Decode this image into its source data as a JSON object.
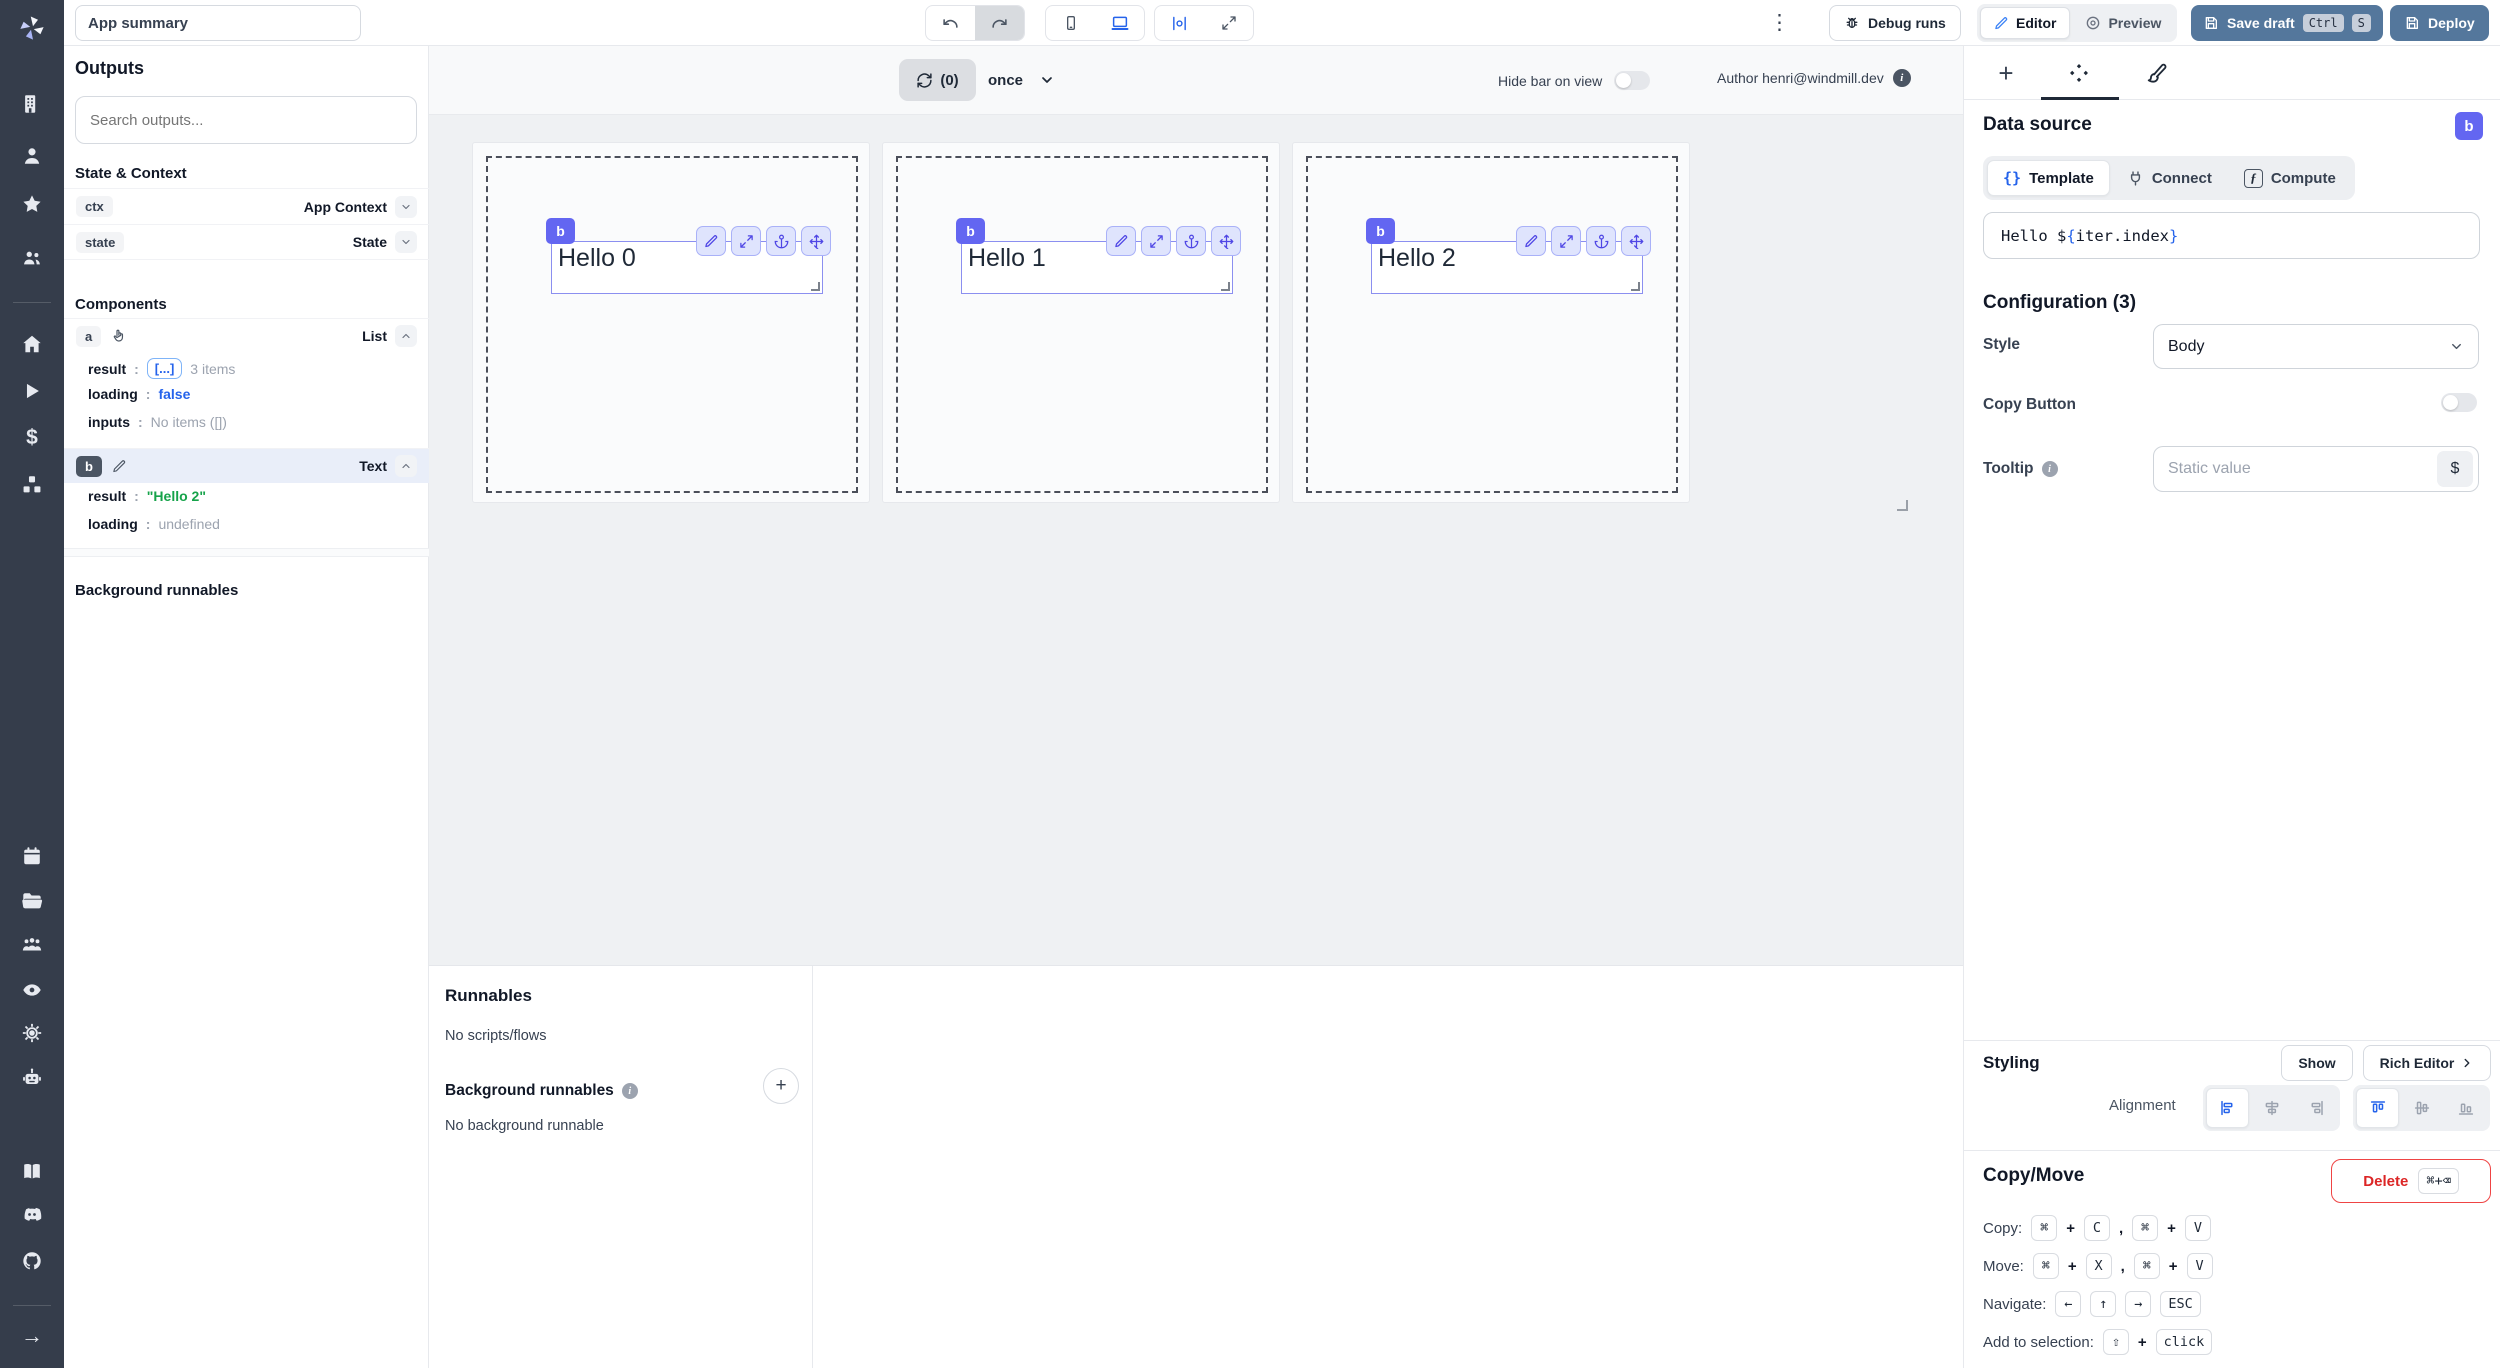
{
  "header": {
    "app_summary": "App summary",
    "debug_runs": "Debug runs",
    "editor": "Editor",
    "preview": "Preview",
    "save_draft": "Save draft",
    "kbd_ctrl": "Ctrl",
    "kbd_s": "S",
    "deploy": "Deploy"
  },
  "icons": {
    "menu": "⋮",
    "plus": "+",
    "dollar": "$",
    "arrow_right": "→",
    "braces": "{}",
    "fx": "ƒ",
    "info": "i"
  },
  "outputs": {
    "title": "Outputs",
    "search_placeholder": "Search outputs...",
    "state_context_title": "State & Context",
    "colon": ":",
    "ctx_key": "ctx",
    "ctx_type": "App Context",
    "state_key": "state",
    "state_type": "State",
    "components_title": "Components",
    "a_key": "a",
    "a_type": "List",
    "a_result_label": "result",
    "a_result_badge": "[...]",
    "a_result_note": "3 items",
    "a_loading_label": "loading",
    "a_loading_value": "false",
    "a_inputs_label": "inputs",
    "a_inputs_value": "No items ([])",
    "b_key": "b",
    "b_type": "Text",
    "b_result_label": "result",
    "b_result_value": "\"Hello 2\"",
    "b_loading_label": "loading",
    "b_loading_value": "undefined",
    "background_title": "Background runnables"
  },
  "canvas": {
    "refresh_count": "(0)",
    "mode": "once",
    "hide_bar_label": "Hide bar on view",
    "author": "Author henri@windmill.dev",
    "items": [
      {
        "badge": "b",
        "text": "Hello 0"
      },
      {
        "badge": "b",
        "text": "Hello 1"
      },
      {
        "badge": "b",
        "text": "Hello 2"
      }
    ]
  },
  "runnables": {
    "title": "Runnables",
    "empty": "No scripts/flows",
    "background_title": "Background runnables",
    "background_empty": "No background runnable"
  },
  "inspector": {
    "data_source_title": "Data source",
    "component_badge": "b",
    "tabs": {
      "template": "Template",
      "connect": "Connect",
      "compute": "Compute"
    },
    "template_parts": {
      "prefix": "Hello $",
      "open": "{",
      "expr": "iter.index",
      "close": "}"
    },
    "configuration_title": "Configuration (3)",
    "style_label": "Style",
    "style_value": "Body",
    "copy_button_label": "Copy Button",
    "tooltip_label": "Tooltip",
    "tooltip_placeholder": "Static value",
    "tooltip_suffix": "$",
    "styling_title": "Styling",
    "show_button": "Show",
    "rich_editor_button": "Rich Editor",
    "alignment_label": "Alignment",
    "copymove_title": "Copy/Move",
    "delete_button": "Delete",
    "delete_kbd": "⌘+⌫",
    "copy_row": {
      "label": "Copy:",
      "k1": "⌘",
      "p1": "+",
      "k2": "C",
      "comma": ",",
      "k3": "⌘",
      "p2": "+",
      "k4": "V"
    },
    "move_row": {
      "label": "Move:",
      "k1": "⌘",
      "p1": "+",
      "k2": "X",
      "comma": ",",
      "k3": "⌘",
      "p2": "+",
      "k4": "V"
    },
    "nav_row": {
      "label": "Navigate:",
      "k1": "←",
      "k2": "↑",
      "k3": "→",
      "k4": "ESC"
    },
    "select_row": {
      "label": "Add to selection:",
      "k1": "⇧",
      "p1": "+",
      "k2": "click"
    }
  },
  "colors": {
    "accent_indigo": "#6366F1",
    "selection_border": "#8B8FF0",
    "save_blue": "#54779C",
    "link_blue": "#2563EB",
    "string_green": "#16A34A",
    "delete_red": "#DC2626",
    "sidebar_dark": "#353D4B"
  }
}
